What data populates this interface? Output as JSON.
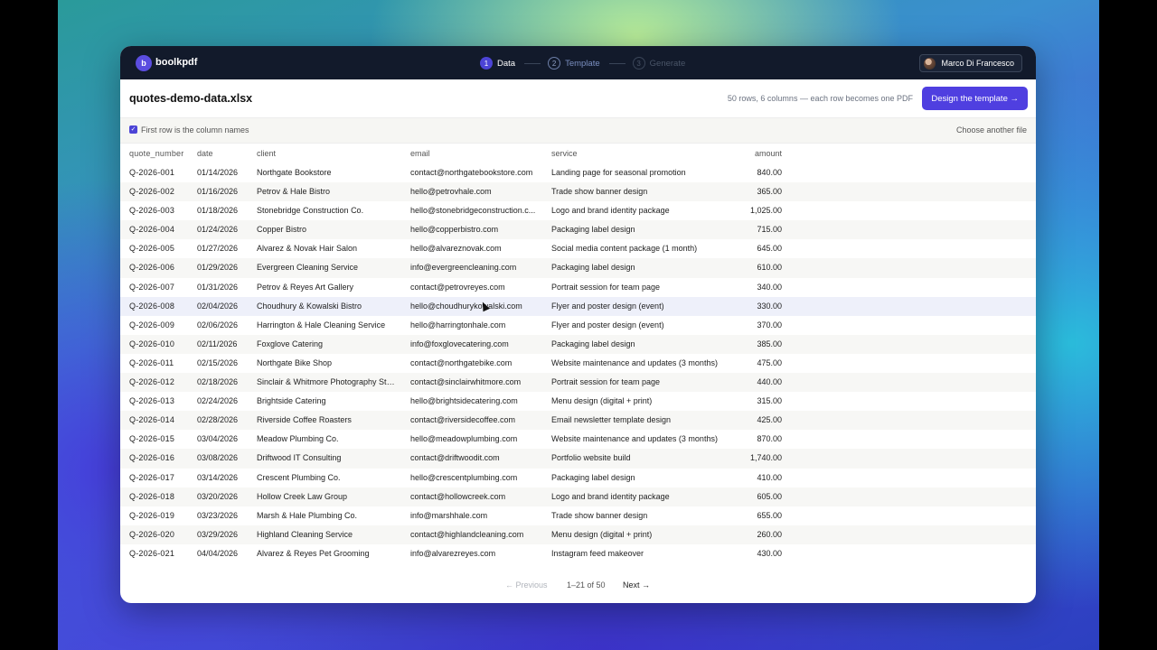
{
  "app": {
    "logo_letter": "b",
    "brand": "boolkpdf",
    "steps": [
      {
        "num": "1",
        "label": "Data"
      },
      {
        "num": "2",
        "label": "Template"
      },
      {
        "num": "3",
        "label": "Generate"
      }
    ],
    "user": "Marco Di Francesco"
  },
  "file": {
    "name": "quotes-demo-data.xlsx",
    "meta": "50 rows, 6 columns — each row becomes one PDF",
    "primary_button": "Design the template →"
  },
  "options": {
    "header_checkbox_label": "First row is the column names",
    "header_checkbox_checked": true,
    "choose_another": "Choose another file"
  },
  "table": {
    "columns": [
      "quote_number",
      "date",
      "client",
      "email",
      "service",
      "amount"
    ],
    "rows": [
      [
        "Q-2026-001",
        "01/14/2026",
        "Northgate Bookstore",
        "contact@northgatebookstore.com",
        "Landing page for seasonal promotion",
        "840.00"
      ],
      [
        "Q-2026-002",
        "01/16/2026",
        "Petrov & Hale Bistro",
        "hello@petrovhale.com",
        "Trade show banner design",
        "365.00"
      ],
      [
        "Q-2026-003",
        "01/18/2026",
        "Stonebridge Construction Co.",
        "hello@stonebridgeconstruction.c...",
        "Logo and brand identity package",
        "1,025.00"
      ],
      [
        "Q-2026-004",
        "01/24/2026",
        "Copper Bistro",
        "hello@copperbistro.com",
        "Packaging label design",
        "715.00"
      ],
      [
        "Q-2026-005",
        "01/27/2026",
        "Alvarez & Novak Hair Salon",
        "hello@alvareznovak.com",
        "Social media content package (1 month)",
        "645.00"
      ],
      [
        "Q-2026-006",
        "01/29/2026",
        "Evergreen Cleaning Service",
        "info@evergreencleaning.com",
        "Packaging label design",
        "610.00"
      ],
      [
        "Q-2026-007",
        "01/31/2026",
        "Petrov & Reyes Art Gallery",
        "contact@petrovreyes.com",
        "Portrait session for team page",
        "340.00"
      ],
      [
        "Q-2026-008",
        "02/04/2026",
        "Choudhury & Kowalski Bistro",
        "hello@choudhurykowalski.com",
        "Flyer and poster design (event)",
        "330.00"
      ],
      [
        "Q-2026-009",
        "02/06/2026",
        "Harrington & Hale Cleaning Service",
        "hello@harringtonhale.com",
        "Flyer and poster design (event)",
        "370.00"
      ],
      [
        "Q-2026-010",
        "02/11/2026",
        "Foxglove Catering",
        "info@foxglovecatering.com",
        "Packaging label design",
        "385.00"
      ],
      [
        "Q-2026-011",
        "02/15/2026",
        "Northgate Bike Shop",
        "contact@northgatebike.com",
        "Website maintenance and updates (3 months)",
        "475.00"
      ],
      [
        "Q-2026-012",
        "02/18/2026",
        "Sinclair & Whitmore Photography Stu...",
        "contact@sinclairwhitmore.com",
        "Portrait session for team page",
        "440.00"
      ],
      [
        "Q-2026-013",
        "02/24/2026",
        "Brightside Catering",
        "hello@brightsidecatering.com",
        "Menu design (digital + print)",
        "315.00"
      ],
      [
        "Q-2026-014",
        "02/28/2026",
        "Riverside Coffee Roasters",
        "contact@riversidecoffee.com",
        "Email newsletter template design",
        "425.00"
      ],
      [
        "Q-2026-015",
        "03/04/2026",
        "Meadow Plumbing Co.",
        "hello@meadowplumbing.com",
        "Website maintenance and updates (3 months)",
        "870.00"
      ],
      [
        "Q-2026-016",
        "03/08/2026",
        "Driftwood IT Consulting",
        "contact@driftwoodit.com",
        "Portfolio website build",
        "1,740.00"
      ],
      [
        "Q-2026-017",
        "03/14/2026",
        "Crescent Plumbing Co.",
        "hello@crescentplumbing.com",
        "Packaging label design",
        "410.00"
      ],
      [
        "Q-2026-018",
        "03/20/2026",
        "Hollow Creek Law Group",
        "contact@hollowcreek.com",
        "Logo and brand identity package",
        "605.00"
      ],
      [
        "Q-2026-019",
        "03/23/2026",
        "Marsh & Hale Plumbing Co.",
        "info@marshhale.com",
        "Trade show banner design",
        "655.00"
      ],
      [
        "Q-2026-020",
        "03/29/2026",
        "Highland Cleaning Service",
        "contact@highlandcleaning.com",
        "Menu design (digital + print)",
        "260.00"
      ],
      [
        "Q-2026-021",
        "04/04/2026",
        "Alvarez & Reyes Pet Grooming",
        "info@alvarezreyes.com",
        "Instagram feed makeover",
        "430.00"
      ]
    ]
  },
  "pager": {
    "previous": "← Previous",
    "range": "1–21 of 50",
    "next": "Next →"
  },
  "colors": {
    "accent": "#4f3fe0",
    "topbar": "#121a2b"
  }
}
